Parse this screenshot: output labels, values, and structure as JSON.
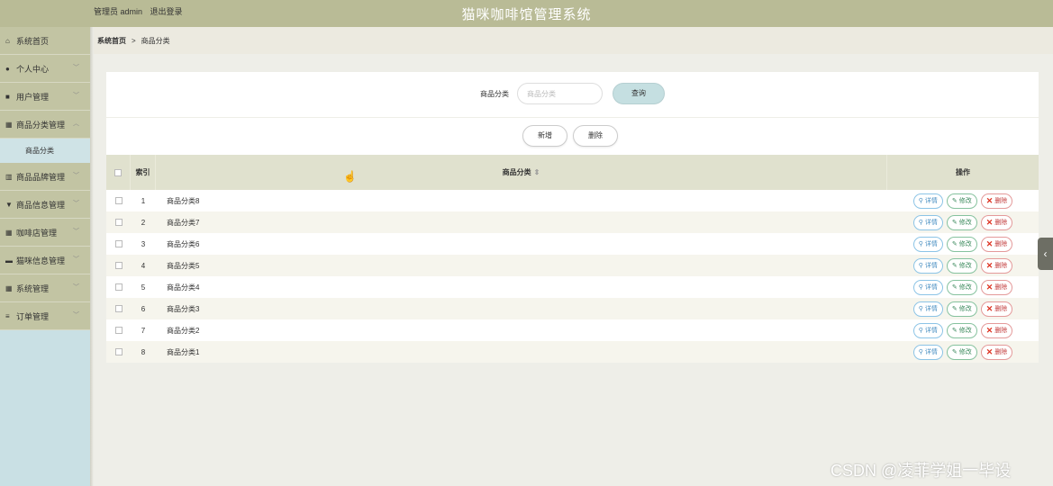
{
  "header": {
    "user_label": "管理员 admin",
    "logout_label": "退出登录",
    "app_title": "猫咪咖啡馆管理系统"
  },
  "sidebar": {
    "items": [
      {
        "label": "系统首页",
        "icon": "home-icon",
        "glyph": "⌂",
        "chevron": false
      },
      {
        "label": "个人中心",
        "icon": "person-icon",
        "glyph": "●",
        "chevron": true
      },
      {
        "label": "用户管理",
        "icon": "users-icon",
        "glyph": "■",
        "chevron": true
      },
      {
        "label": "商品分类管理",
        "icon": "grid-icon",
        "glyph": "▦",
        "chevron": true,
        "expanded": true
      },
      {
        "label": "商品品牌管理",
        "icon": "archive-icon",
        "glyph": "▥",
        "chevron": true
      },
      {
        "label": "商品信息管理",
        "icon": "tag-icon",
        "glyph": "▼",
        "chevron": true
      },
      {
        "label": "咖啡店管理",
        "icon": "grid-icon",
        "glyph": "▦",
        "chevron": true
      },
      {
        "label": "猫咪信息管理",
        "icon": "monitor-icon",
        "glyph": "▬",
        "chevron": true
      },
      {
        "label": "系统管理",
        "icon": "grid-icon",
        "glyph": "▦",
        "chevron": true
      },
      {
        "label": "订单管理",
        "icon": "list-icon",
        "glyph": "≡",
        "chevron": true
      }
    ],
    "active_sub": "商品分类"
  },
  "breadcrumb": {
    "home": "系统首页",
    "separator": ">",
    "current": "商品分类"
  },
  "search": {
    "label": "商品分类",
    "placeholder": "商品分类",
    "value": "",
    "button": "查询"
  },
  "actions": {
    "add": "新增",
    "delete": "删除"
  },
  "table": {
    "headers": {
      "index": "索引",
      "name": "商品分类",
      "ops": "操作"
    },
    "rows": [
      {
        "index": "1",
        "name": "商品分类8"
      },
      {
        "index": "2",
        "name": "商品分类7"
      },
      {
        "index": "3",
        "name": "商品分类6"
      },
      {
        "index": "4",
        "name": "商品分类5"
      },
      {
        "index": "5",
        "name": "商品分类4"
      },
      {
        "index": "6",
        "name": "商品分类3"
      },
      {
        "index": "7",
        "name": "商品分类2"
      },
      {
        "index": "8",
        "name": "商品分类1"
      }
    ],
    "row_ops": {
      "detail": "详情",
      "edit": "修改",
      "remove": "删除"
    }
  },
  "watermark": "CSDN @凌菲学姐一毕设"
}
